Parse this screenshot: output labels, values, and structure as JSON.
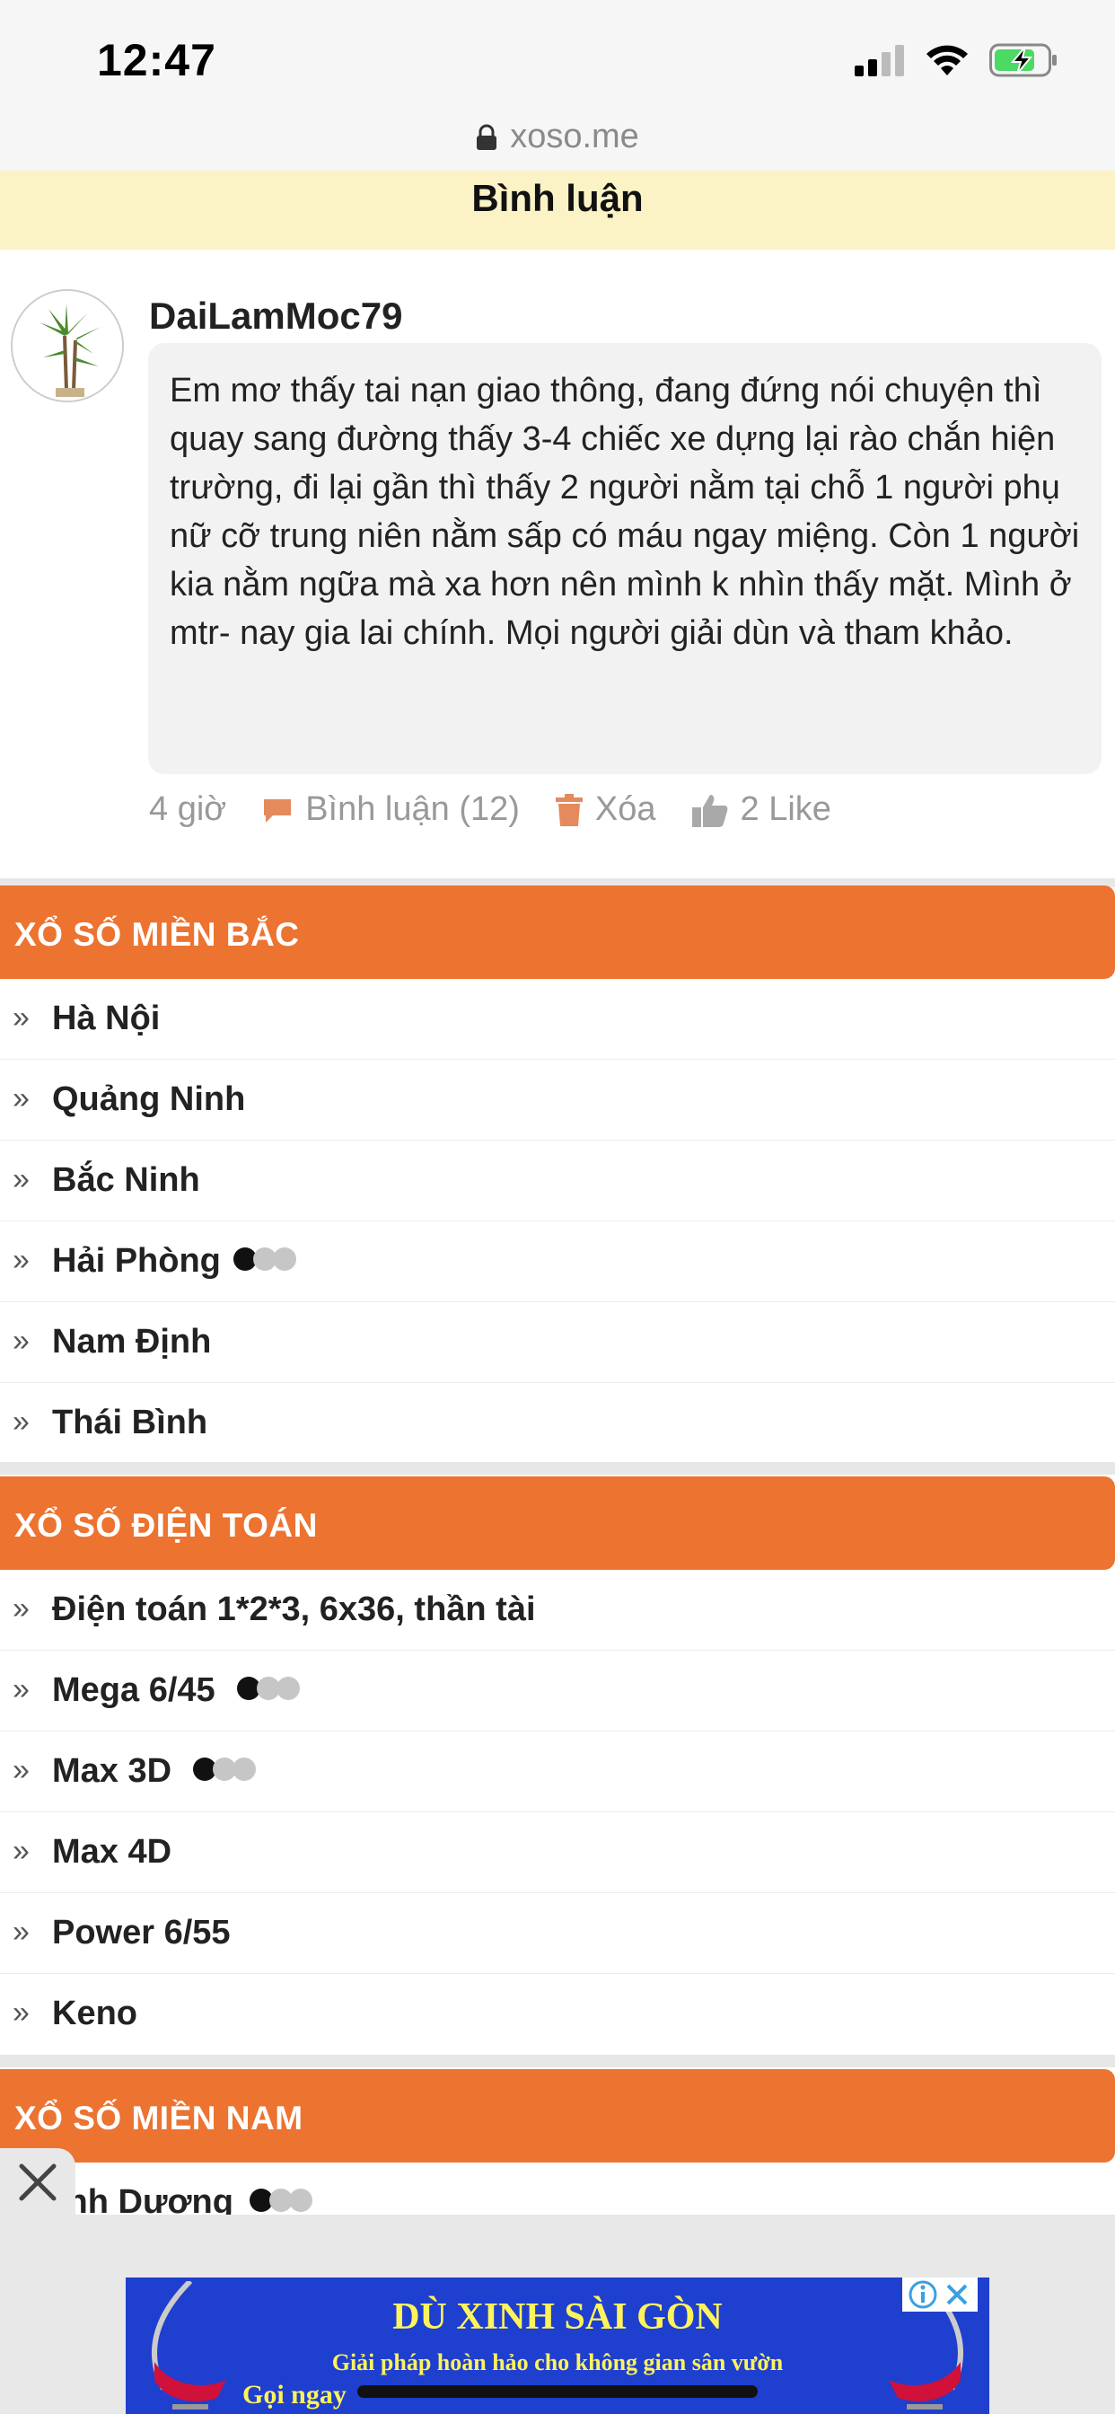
{
  "status_bar": {
    "time": "12:47",
    "url": "xoso.me"
  },
  "header": {
    "title": "Bình luận"
  },
  "comment": {
    "author": "DaiLamMoc79",
    "text": "Em mơ thấy tai nạn giao thông, đang đứng nói chuyện thì quay sang đường thấy 3-4 chiếc xe dựng lại rào chắn hiện trường, đi lại gần thì thấy 2 người nằm tại chỗ 1 người phụ nữ cỡ trung niên nằm sấp có máu ngay miệng. Còn 1 người kia nằm ngữa mà xa hơn nên mình k nhìn thấy mặt. Mình ở mtr- nay gia lai chính. Mọi người giải dùn và tham khảo.",
    "time_ago": "4 giờ",
    "reply_label": "Bình luận (12)",
    "delete_label": "Xóa",
    "like_label": "2 Like"
  },
  "sections": [
    {
      "title": "XỔ SỐ MIỀN BẮC",
      "items": [
        {
          "label": "Hà Nội",
          "live": false
        },
        {
          "label": "Quảng Ninh",
          "live": false
        },
        {
          "label": "Bắc Ninh",
          "live": false
        },
        {
          "label": "Hải Phòng",
          "live": true
        },
        {
          "label": "Nam Định",
          "live": false
        },
        {
          "label": "Thái Bình",
          "live": false
        }
      ]
    },
    {
      "title": "XỔ SỐ ĐIỆN TOÁN",
      "items": [
        {
          "label": "Điện toán 1*2*3, 6x36, thần tài",
          "live": false
        },
        {
          "label": "Mega 6/45",
          "live": true
        },
        {
          "label": "Max 3D",
          "live": true
        },
        {
          "label": "Max 4D",
          "live": false
        },
        {
          "label": "Power 6/55",
          "live": false
        },
        {
          "label": "Keno",
          "live": false
        }
      ]
    },
    {
      "title": "XỔ SỐ MIỀN NAM",
      "items": [
        {
          "label": "ình Dương",
          "live": true
        }
      ]
    }
  ],
  "ad": {
    "title": "DÙ XINH SÀI GÒN",
    "subtitle": "Giải pháp hoàn hảo cho không gian sân vườn",
    "call_label": "Gọi ngay"
  },
  "colors": {
    "accent": "#ec7330",
    "header_bg": "#fbf2c6",
    "ad_bg": "#1f3fcf"
  }
}
